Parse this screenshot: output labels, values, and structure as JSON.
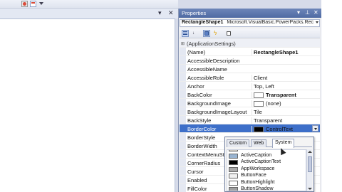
{
  "props_panel": {
    "title": "Properties",
    "title_buttons": [
      "▾",
      "⊥",
      "✕"
    ],
    "selector_name": "RectangleShape1",
    "selector_type": "Microsoft.VisualBasic.PowerPacks.Rec"
  },
  "doc_header": {
    "pin": "▾",
    "close": "✕"
  },
  "toolbar_icons": [
    "categorized-icon",
    "alphabetical-icon",
    "properties-icon",
    "events-icon",
    "property-pages-icon"
  ],
  "rows": [
    {
      "name": "(ApplicationSettings)",
      "value": "",
      "group": true
    },
    {
      "name": "(Name)",
      "value": "RectangleShape1",
      "bold": true
    },
    {
      "name": "AccessibleDescription",
      "value": ""
    },
    {
      "name": "AccessibleName",
      "value": ""
    },
    {
      "name": "AccessibleRole",
      "value": "Client"
    },
    {
      "name": "Anchor",
      "value": "Top, Left"
    },
    {
      "name": "BackColor",
      "value": "Transparent",
      "bold": true,
      "swatch": "#ffffff"
    },
    {
      "name": "BackgroundImage",
      "value": "(none)",
      "swatch": "#ffffff"
    },
    {
      "name": "BackgroundImageLayout",
      "value": "Tile"
    },
    {
      "name": "BackStyle",
      "value": "Transparent"
    },
    {
      "name": "BorderColor",
      "value": "ControlText",
      "swatch": "#000000",
      "selected": true
    },
    {
      "name": "BorderStyle",
      "value": ""
    },
    {
      "name": "BorderWidth",
      "value": ""
    },
    {
      "name": "ContextMenuSt",
      "value": ""
    },
    {
      "name": "CornerRadius",
      "value": ""
    },
    {
      "name": "Cursor",
      "value": ""
    },
    {
      "name": "Enabled",
      "value": ""
    },
    {
      "name": "FillColor",
      "value": ""
    }
  ],
  "color_dropdown": {
    "tabs": [
      "Custom",
      "Web",
      "System"
    ],
    "active_tab": "System",
    "items": [
      {
        "label": "ActiveBorder",
        "color": "#d4d0c8"
      },
      {
        "label": "ActiveCaption",
        "color": "#99b4d1"
      },
      {
        "label": "ActiveCaptionText",
        "color": "#000000"
      },
      {
        "label": "AppWorkspace",
        "color": "#ababab"
      },
      {
        "label": "ButtonFace",
        "color": "#f0f0f0"
      },
      {
        "label": "ButtonHighlight",
        "color": "#ffffff"
      },
      {
        "label": "ButtonShadow",
        "color": "#a0a0a0"
      }
    ]
  }
}
